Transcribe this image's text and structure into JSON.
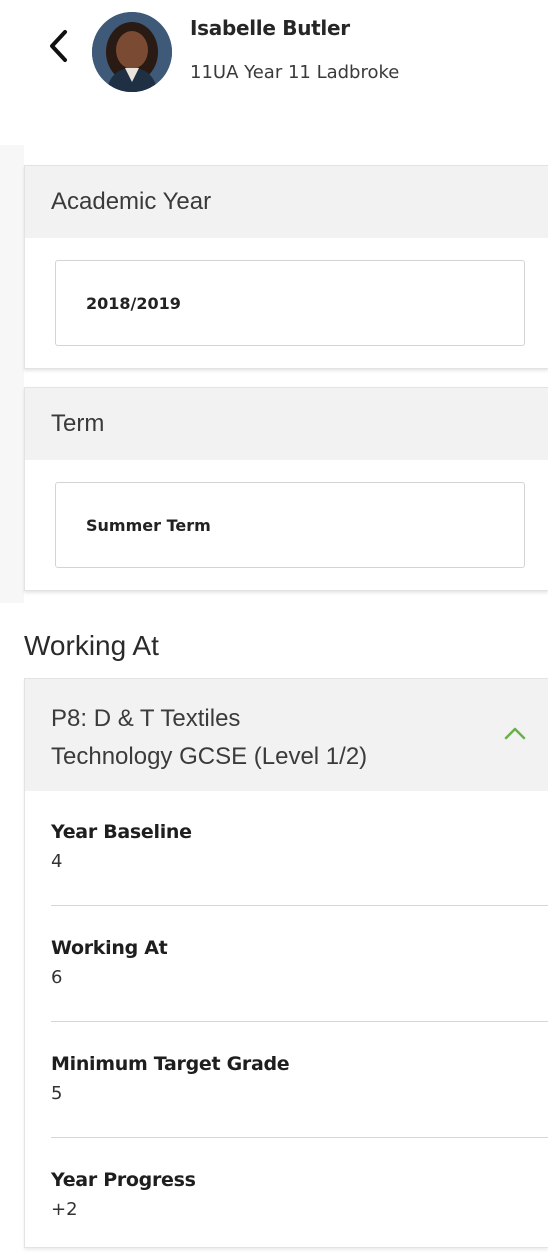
{
  "header": {
    "back_icon": "chevron-left-icon",
    "student_name": "Isabelle Butler",
    "student_meta": "11UA  Year 11  Ladbroke"
  },
  "academic_year": {
    "label": "Academic Year",
    "value": "2018/2019"
  },
  "term": {
    "label": "Term",
    "value": "Summer Term"
  },
  "working_at_section": {
    "title": "Working At",
    "subject": {
      "line1": "P8: D & T Textiles",
      "line2": "Technology GCSE (Level 1/2)",
      "expand_icon": "chevron-up-icon",
      "accent": "#6ab04c",
      "stats": [
        {
          "label": "Year Baseline",
          "value": "4"
        },
        {
          "label": "Working At",
          "value": "6"
        },
        {
          "label": "Minimum Target Grade",
          "value": "5"
        },
        {
          "label": "Year Progress",
          "value": "+2"
        }
      ]
    }
  }
}
